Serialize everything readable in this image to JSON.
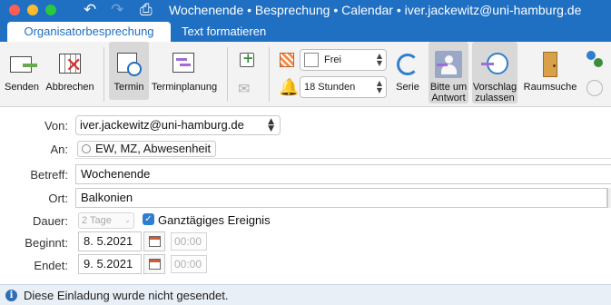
{
  "window": {
    "title": "Wochenende • Besprechung • Calendar • iver.jackewitz@uni-hamburg.de"
  },
  "tabs": [
    {
      "label": "Organisatorbesprechung",
      "active": true
    },
    {
      "label": "Text formatieren",
      "active": false
    }
  ],
  "ribbon": {
    "send": "Senden",
    "cancel": "Abbrechen",
    "appointment": "Termin",
    "scheduling": "Terminplanung",
    "show_as": "Frei",
    "reminder": "18 Stunden",
    "series": "Serie",
    "request_response_line1": "Bitte um",
    "request_response_line2": "Antwort",
    "propose_line1": "Vorschlag",
    "propose_line2": "zulassen",
    "room_finder": "Raumsuche"
  },
  "form": {
    "from_label": "Von:",
    "from_value": "iver.jackewitz@uni-hamburg.de",
    "to_label": "An:",
    "to_chip": "EW, MZ, Abwesenheit",
    "subject_label": "Betreff:",
    "subject_value": "Wochenende",
    "location_label": "Ort:",
    "location_value": "Balkonien",
    "duration_label": "Dauer:",
    "duration_value": "2 Tage",
    "all_day_label": "Ganztägiges Ereignis",
    "all_day_checked": true,
    "start_label": "Beginnt:",
    "start_date": "8.  5.2021",
    "start_time": "00:00",
    "end_label": "Endet:",
    "end_date": "9.  5.2021",
    "end_time": "00:00"
  },
  "status": {
    "message": "Diese Einladung wurde nicht gesendet."
  },
  "colors": {
    "accent": "#1f6fc2",
    "checkbox": "#2f7fd0"
  }
}
